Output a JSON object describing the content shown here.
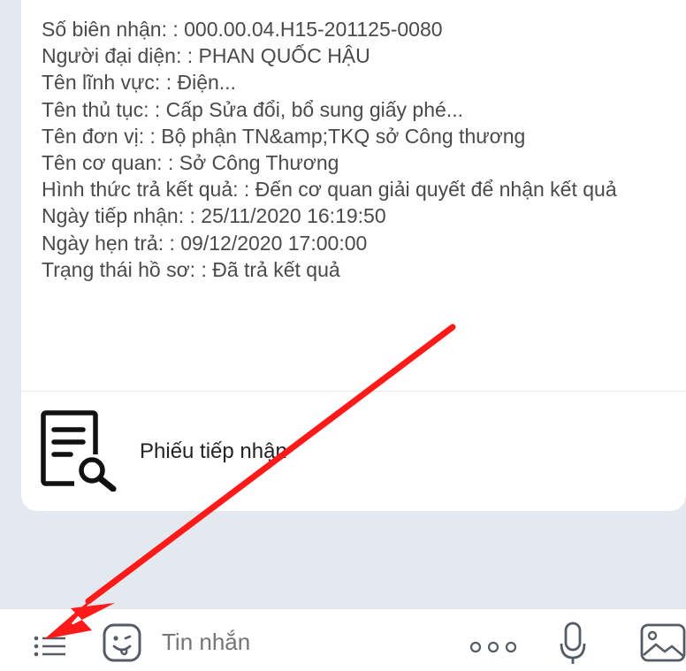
{
  "message_card": {
    "fields": [
      {
        "label": "Số biên nhận:",
        "value": ": 000.00.04.H15-201125-0080"
      },
      {
        "label": "Người đại diện:",
        "value": ": PHAN QUỐC HẬU"
      },
      {
        "label": "Tên lĩnh vực:",
        "value": ": Điện..."
      },
      {
        "label": "Tên thủ tục:",
        "value": ": Cấp Sửa đổi, bổ sung giấy phé..."
      },
      {
        "label": "Tên đơn vị:",
        "value": ": Bộ phận TN&amp;TKQ sở Công thương"
      },
      {
        "label": "Tên cơ quan:",
        "value": ": Sở Công Thương"
      },
      {
        "label": "Hình thức trả kết quả:",
        "value": ": Đến cơ quan giải quyết để nhận kết quả"
      },
      {
        "label": "Ngày tiếp nhận:",
        "value": ": 25/11/2020 16:19:50"
      },
      {
        "label": "Ngày hẹn trả:",
        "value": ": 09/12/2020 17:00:00"
      },
      {
        "label": "Trạng thái hồ sơ:",
        "value": ": Đã trả kết quả"
      }
    ],
    "receipt": {
      "label": "Phiếu tiếp nhận",
      "icon": "document-search-icon"
    }
  },
  "chat_bar": {
    "menu_icon": "list-menu-icon",
    "emoji_icon": "sticker-face-icon",
    "input_placeholder": "Tin nhắn",
    "more_icon": "more-dots-icon",
    "mic_icon": "microphone-icon",
    "image_icon": "image-icon"
  },
  "annotation": {
    "arrow_color": "#ff1a1a"
  },
  "colors": {
    "background": "#e4e8ef",
    "card": "#ffffff",
    "text": "#4a4a4a",
    "icon": "#555c66"
  }
}
